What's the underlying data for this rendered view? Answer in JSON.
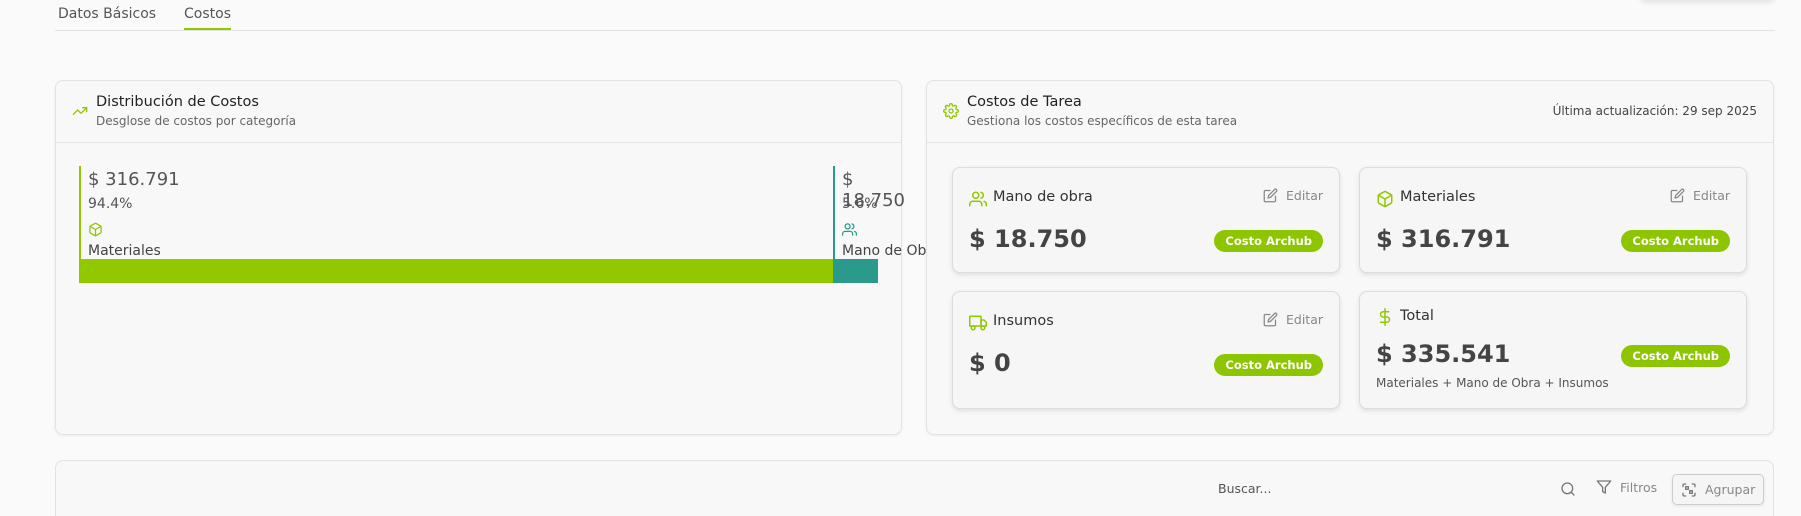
{
  "tabs": [
    {
      "label": "Datos Básicos",
      "active": false
    },
    {
      "label": "Costos",
      "active": true
    }
  ],
  "distribution": {
    "title": "Distribución de Costos",
    "subtitle": "Desglose de costos por categoría",
    "items": [
      {
        "amount": "$ 316.791",
        "percent": "94.4%",
        "label": "Materiales",
        "share": 0.944,
        "color": "#92c800",
        "icon": "package-icon"
      },
      {
        "amount": "$ 18.750",
        "percent": "5.6%",
        "label": "Mano de Obra",
        "share": 0.056,
        "color": "#2a9a8c",
        "icon": "users-icon"
      }
    ]
  },
  "task_costs": {
    "title": "Costos de Tarea",
    "subtitle": "Gestiona los costos específicos de esta tarea",
    "last_update": "Última actualización: 29 sep 2025",
    "edit_label": "Editar",
    "badge_label": "Costo Archub",
    "cards": [
      {
        "title": "Mano de obra",
        "amount": "$ 18.750",
        "icon": "users-icon"
      },
      {
        "title": "Materiales",
        "amount": "$ 316.791",
        "icon": "package-icon"
      },
      {
        "title": "Insumos",
        "amount": "$ 0",
        "icon": "truck-icon"
      },
      {
        "title": "Total",
        "amount": "$ 335.541",
        "icon": "dollar-icon",
        "note": "Materiales + Mano de Obra + Insumos"
      }
    ]
  },
  "toolbar": {
    "search_placeholder": "Buscar...",
    "filters_label": "Filtros",
    "group_label": "Agrupar"
  },
  "colors": {
    "accent": "#92c800",
    "teal": "#2a9a8c",
    "badge": "#8dc600"
  }
}
